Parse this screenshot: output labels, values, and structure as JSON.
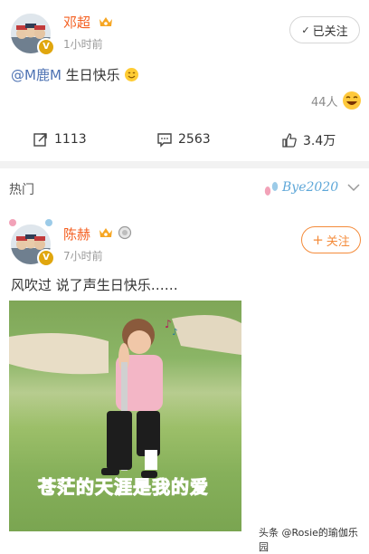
{
  "post1": {
    "username": "邓超",
    "time": "1小时前",
    "follow_label": "已关注",
    "mention": "@M鹿M",
    "text": " 生日快乐",
    "likes_count": "44人",
    "actions": {
      "repost_count": "1113",
      "comment_count": "2563",
      "like_count": "3.4万"
    }
  },
  "hot": {
    "label": "热门",
    "badge_text": "Bye2020"
  },
  "post2": {
    "username": "陈赫",
    "time": "7小时前",
    "follow_label": "关注",
    "text": "风吹过 说了声生日快乐……",
    "image_caption": "苍茫的天涯是我的爱"
  },
  "footer": {
    "watermark": "头条 @Rosie的瑜伽乐园"
  },
  "colors": {
    "username": "#f45f20",
    "mention": "#4d72b3",
    "follow_accent": "#f48b3a",
    "caption": "#ff2f6f"
  }
}
